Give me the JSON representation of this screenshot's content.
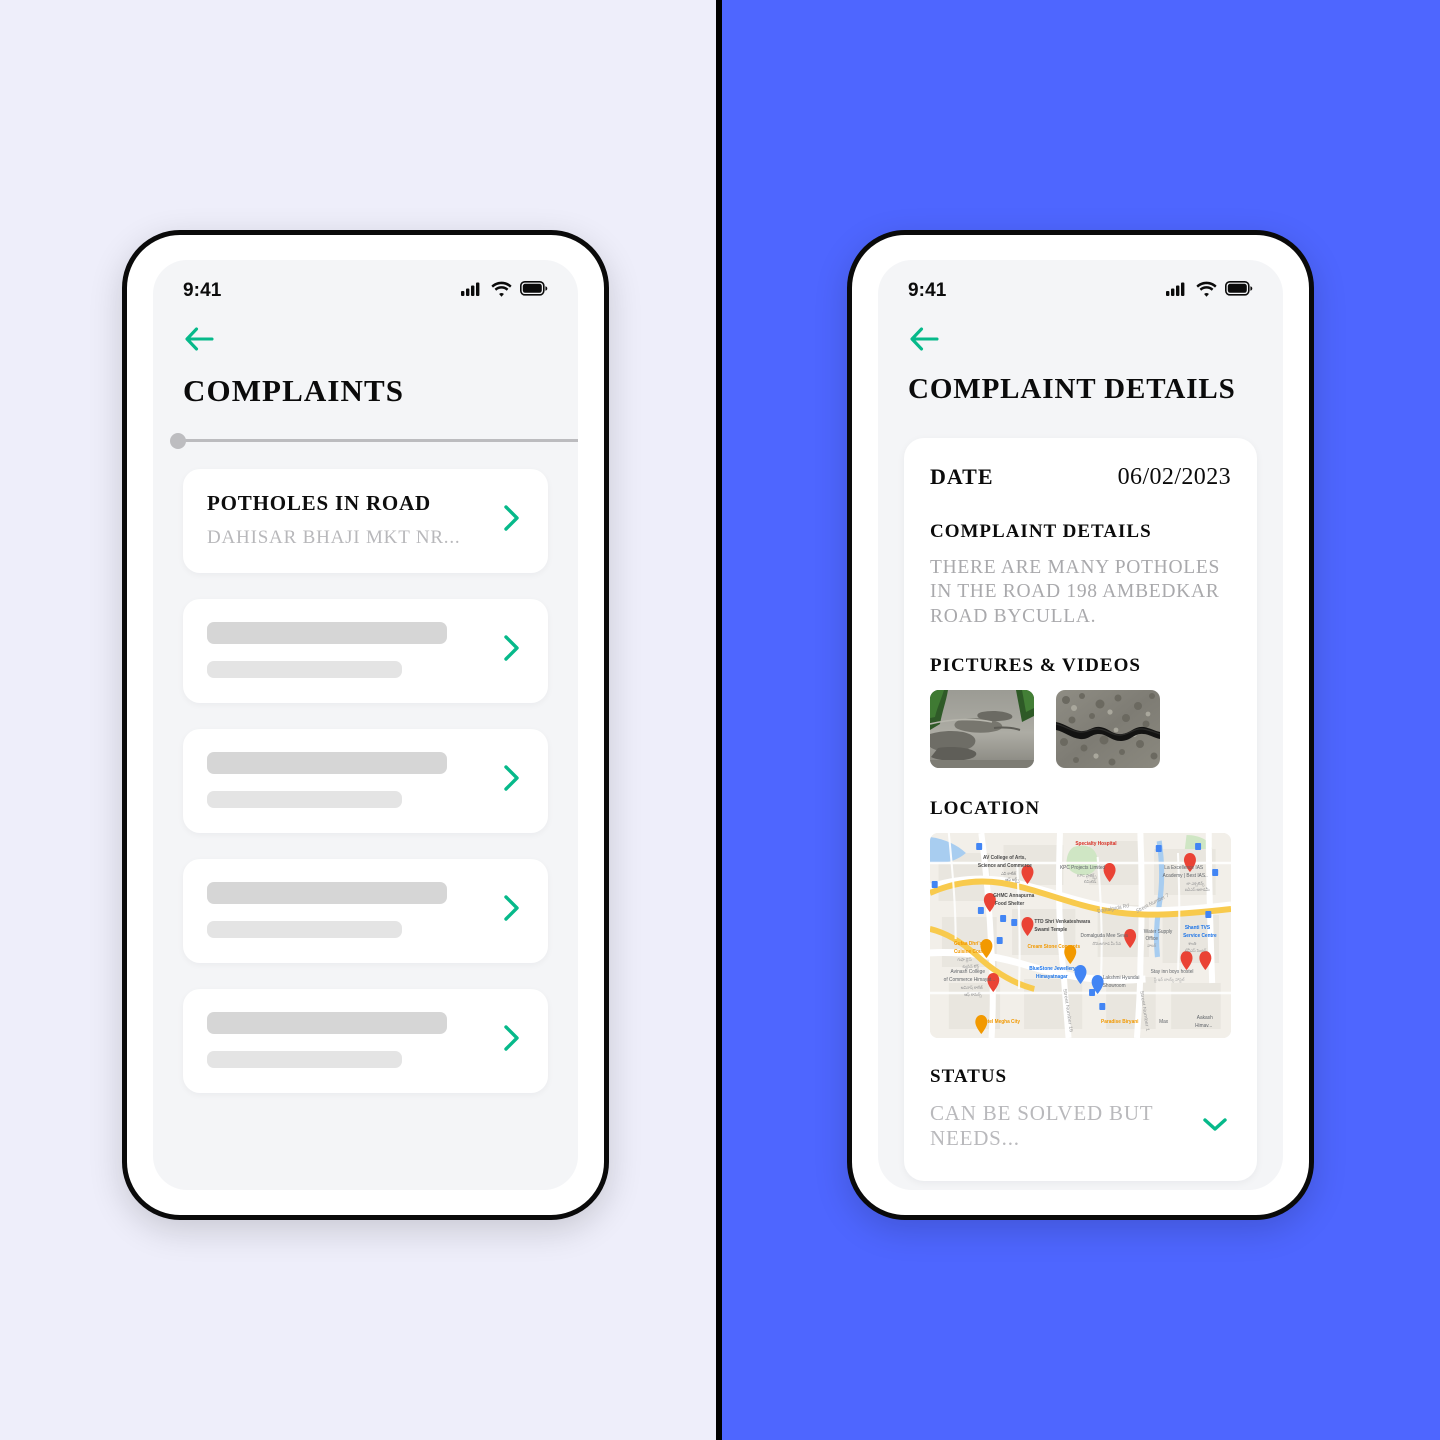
{
  "theme": {
    "left_bg": "#eeeefa",
    "right_bg": "#4e66ff",
    "divider": "#000000",
    "accent_green": "#06b98a",
    "card_bg": "#ffffff",
    "screen_bg": "#f4f5f7",
    "muted_text": "#b8b8bb",
    "skeleton_dark": "#d6d6d6",
    "skeleton_light": "#e4e4e4"
  },
  "status_bar": {
    "time": "9:41",
    "icons": [
      "cellular-signal-icon",
      "wifi-icon",
      "battery-icon"
    ]
  },
  "screen_complaints": {
    "back_icon": "arrow-left-icon",
    "title": "COMPLAINTS",
    "rail": {
      "knob_position": "start"
    },
    "items": [
      {
        "type": "filled",
        "title": "POTHOLES IN ROAD",
        "subtitle": "DAHISAR BHAJI MKT NR...",
        "chevron": "chevron-right-icon"
      },
      {
        "type": "skeleton",
        "chevron": "chevron-right-icon"
      },
      {
        "type": "skeleton",
        "chevron": "chevron-right-icon"
      },
      {
        "type": "skeleton",
        "chevron": "chevron-right-icon"
      },
      {
        "type": "skeleton",
        "chevron": "chevron-right-icon"
      }
    ]
  },
  "screen_details": {
    "back_icon": "arrow-left-icon",
    "title": "COMPLAINT DETAILS",
    "date_label": "DATE",
    "date_value": "06/02/2023",
    "complaint_label": "COMPLAINT DETAILS",
    "complaint_text": "THERE ARE MANY POTHOLES IN THE ROAD 198 AMBEDKAR ROAD BYCULLA.",
    "media_label": "PICTURES & VIDEOS",
    "media": [
      {
        "alt": "pothole-damaged-road-photo"
      },
      {
        "alt": "cracked-asphalt-closeup-photo"
      }
    ],
    "location_label": "LOCATION",
    "map": {
      "alt": "google-map-himayatnagar",
      "labels": [
        "Specialty Hospital",
        "AV College of Arts, Science and Commerce",
        "KPC Projects Limited",
        "La Excellence IAS Academy | Best IAS..",
        "GHMC Annapurna Food Shelter",
        "TTD Shri Venkateshwara Swami Temple",
        "Domalguda Mee Seva",
        "Water Supply Office",
        "Shanti TVS Service Centre",
        "Street Number 7",
        "Domalguda Rd",
        "Gufaa Dhri's Cuisine Court",
        "Cream Stone Concepts",
        "Avinash College of Commerce Himayat...",
        "BlueStone Jewellery Himayatnagar",
        "Lakshmi Hyundai Showroom",
        "Stay Inn boys hostel",
        "Hotel Megha City",
        "Paradise Biryani",
        "Max",
        "Aakash Himav...",
        "Street Number 1",
        "Street Number 16"
      ]
    },
    "status_label": "STATUS",
    "status_value": "CAN BE SOLVED BUT NEEDS...",
    "status_chevron": "chevron-down-icon"
  }
}
